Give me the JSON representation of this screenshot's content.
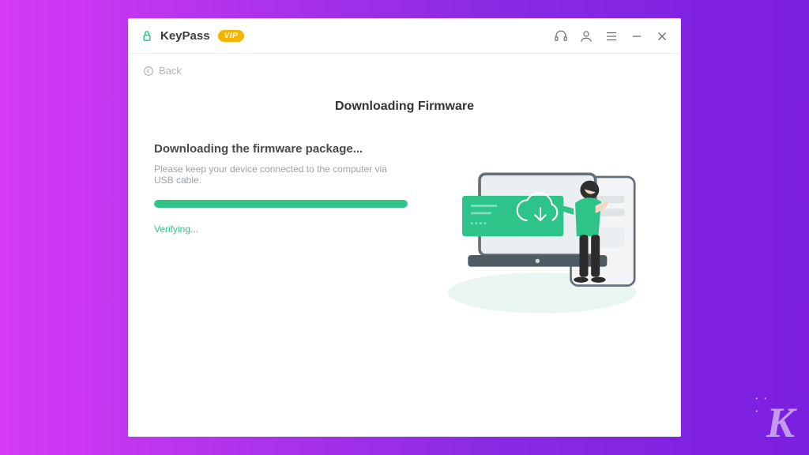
{
  "titlebar": {
    "app_name": "KeyPass",
    "vip_label": "VIP"
  },
  "nav": {
    "back_label": "Back"
  },
  "page": {
    "title": "Downloading Firmware"
  },
  "download": {
    "subtitle": "Downloading the firmware package...",
    "instruction": "Please keep your device connected to the computer via USB cable.",
    "status_text": "Verifying...",
    "progress_percent": 100
  },
  "colors": {
    "accent": "#2ec389",
    "vip": "#f5b400",
    "text_muted": "#9da3a7"
  },
  "watermark": {
    "letter": "K"
  }
}
